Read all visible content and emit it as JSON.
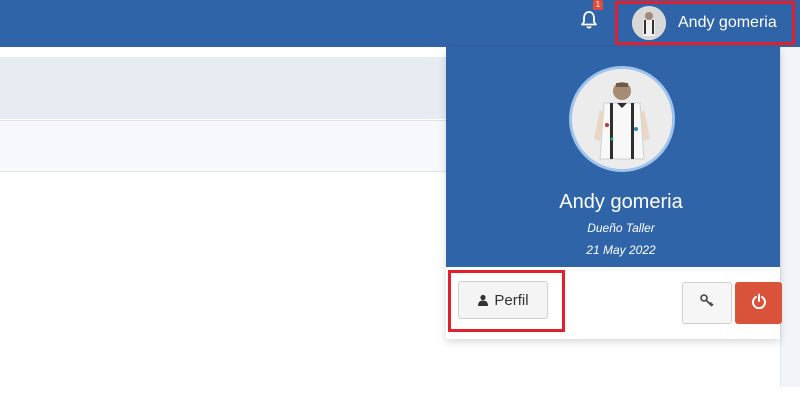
{
  "topbar": {
    "color": "#2f64a8",
    "bell_icon": "bell-icon",
    "notification_badge": "1",
    "user_toggle_name": "Andy gomeria"
  },
  "dropdown": {
    "name": "Andy gomeria",
    "role": "Dueño Taller",
    "date": "21 May 2022",
    "perfil_label": "Perfil",
    "perfil_icon": "user-icon",
    "key_icon": "key-icon",
    "power_icon": "power-icon",
    "power_color": "#d9533b",
    "highlight_color": "#e0202e"
  }
}
